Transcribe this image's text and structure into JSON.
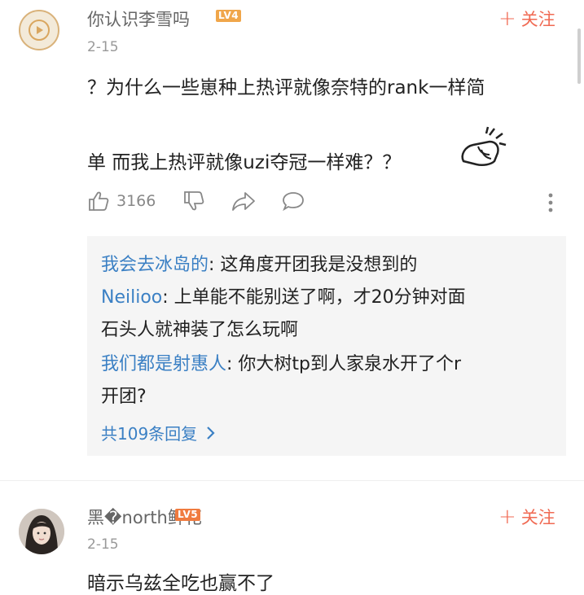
{
  "comments": [
    {
      "username": "你认识李雪吗",
      "level": "LV4",
      "date": "2-15",
      "follow_label": "关注",
      "text_line1": "？为什么一些崽种上热评就像奈特的rank一样简",
      "text_line2": "单 而我上热评就像uzi夺冠一样难？？",
      "like_count": "3166",
      "replies": [
        {
          "name": "我会去冰岛的",
          "text": "这角度开团我是没想到的"
        },
        {
          "name": "Neilioo",
          "text": "上单能不能别送了啊，才20分钟对面",
          "text_cont": "石头人就神装了怎么玩啊"
        },
        {
          "name": "我们都是射惠人",
          "text": "你大树tp到人家泉水开了个r",
          "text_cont": "开团?"
        }
      ],
      "more_replies": "共109条回复"
    },
    {
      "username": "黑�north鲜花",
      "level": "LV5",
      "date": "2-15",
      "follow_label": "关注",
      "text_line1": "暗示乌兹全吃也赢不了"
    }
  ],
  "colors": {
    "accent": "#f06a53",
    "link": "#3b80c4",
    "level4": "#f0a64a",
    "level5": "#f07b3f"
  }
}
